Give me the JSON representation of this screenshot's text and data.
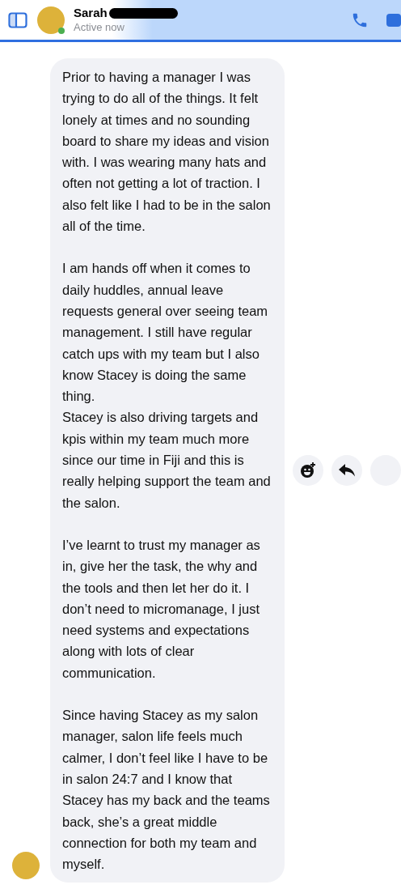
{
  "header": {
    "name": "Sarah",
    "status": "Active now"
  },
  "message": {
    "paragraphs": [
      "Prior to having a manager I was trying to do all of the things. It felt lonely at times and no sounding board to share my ideas and vision with. I was wearing many hats and often not getting a lot of traction. I also felt like I had to be in the salon all of the time.",
      "I am hands off when it comes to daily huddles, annual leave requests general over seeing team management. I still have regular catch ups with my team but I also know Stacey is doing the same thing.\nStacey is also driving targets and kpis within my team much more since our time in Fiji and this is really helping support the team and the salon.",
      "I’ve learnt to trust my manager as in, give her the task, the why and the tools and then let her do it. I don’t need to micromanage, I just need systems and expectations along with lots of clear communication.",
      "Since having Stacey as my salon manager, salon life feels much calmer, I don’t feel like I have to be in salon 24:7 and I know that Stacey has my back and the teams back, she’s a great middle connection for both my team and myself."
    ]
  }
}
